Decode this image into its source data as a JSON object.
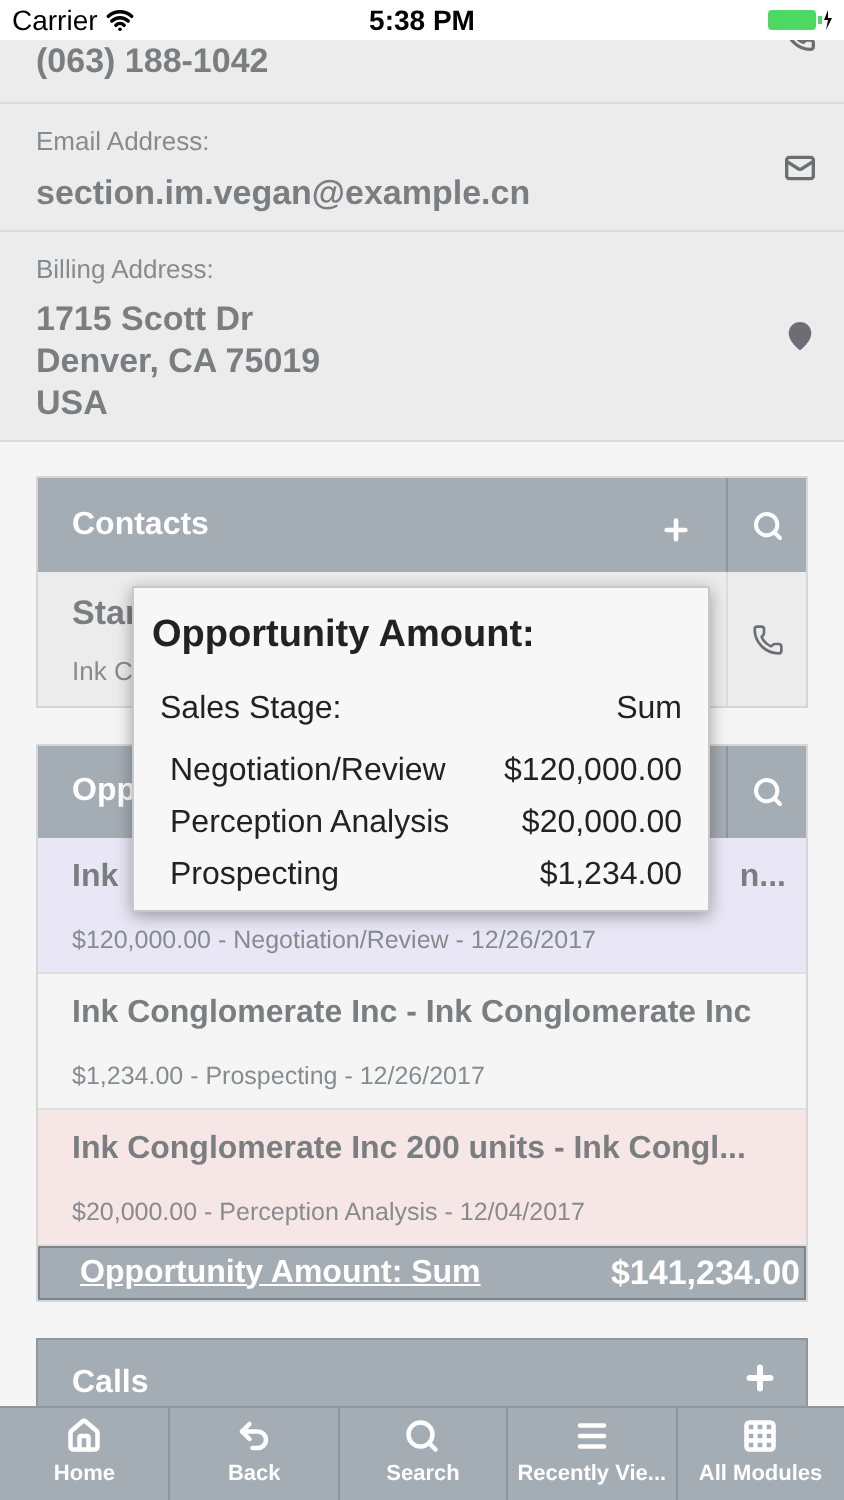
{
  "status_bar": {
    "carrier": "Carrier",
    "time": "5:38 PM"
  },
  "details": [
    {
      "kind": "phone",
      "value": "(063) 188-1042"
    },
    {
      "kind": "email",
      "label": "Email Address:",
      "value": "section.im.vegan@example.cn"
    },
    {
      "kind": "address",
      "label": "Billing Address:",
      "value": "1715 Scott Dr\nDenver, CA 75019\nUSA"
    }
  ],
  "contacts": {
    "title": "Contacts",
    "rows": [
      {
        "title": "Star",
        "subtitle": "Ink C"
      }
    ]
  },
  "opportunities": {
    "title": "Opp",
    "rows": [
      {
        "title": "Ink",
        "title_end": "n...",
        "subtitle": "$120,000.00 - Negotiation/Review - 12/26/2017",
        "color": "#e9e7f5"
      },
      {
        "title": "Ink Conglomerate Inc - Ink Conglomerate Inc",
        "title_end": "",
        "subtitle": "$1,234.00 - Prospecting - 12/26/2017",
        "color": "#f5f5f5"
      },
      {
        "title": "Ink Conglomerate Inc 200 units - Ink Congl...",
        "title_end": "",
        "subtitle": "$20,000.00 - Perception Analysis - 12/04/2017",
        "color": "#f7e6e6"
      }
    ],
    "summary_label": "Opportunity Amount: Sum",
    "summary_value": "$141,234.00"
  },
  "calls": {
    "title": "Calls"
  },
  "popup": {
    "title": "Opportunity Amount:",
    "header": [
      "Sales Stage:",
      "Sum"
    ],
    "rows": [
      {
        "stage": "Negotiation/Review",
        "sum": "$120,000.00"
      },
      {
        "stage": "Perception Analysis",
        "sum": "$20,000.00"
      },
      {
        "stage": "Prospecting",
        "sum": "$1,234.00"
      }
    ]
  },
  "tab_bar": [
    {
      "kind": "home",
      "label": "Home"
    },
    {
      "kind": "back",
      "label": "Back"
    },
    {
      "kind": "search",
      "label": "Search"
    },
    {
      "kind": "recent",
      "label": "Recently Vie..."
    },
    {
      "kind": "modules",
      "label": "All Modules"
    }
  ]
}
